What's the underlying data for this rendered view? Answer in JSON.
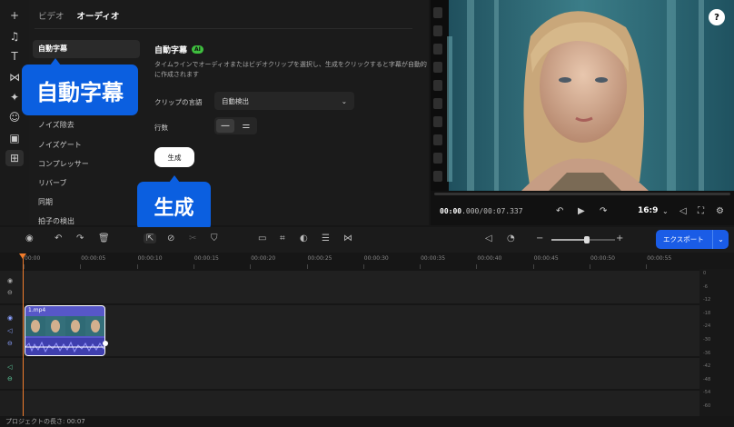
{
  "rail": {
    "icons": [
      "plus-icon",
      "music-icon",
      "text-icon",
      "transition-icon",
      "effects-icon",
      "sticker-icon",
      "record-icon",
      "apps-icon"
    ]
  },
  "panel": {
    "tabs": [
      "ビデオ",
      "オーディオ"
    ],
    "active_tab": "オーディオ",
    "side_items": [
      "自動字幕",
      "ノイズ除去",
      "ノイズゲート",
      "コンプレッサー",
      "リバーブ",
      "同期",
      "拍子の検出"
    ],
    "title": "自動字幕",
    "ai_badge": "AI",
    "description": "タイムラインでオーディオまたはビデオクリップを選択し、生成をクリックすると字幕が自動的に作成されます",
    "clip_language_label": "クリップの言語",
    "clip_language_value": "自動検出",
    "rows_label": "行数",
    "generate_button": "生成"
  },
  "callouts": {
    "auto_subtitles": "自動字幕",
    "generate": "生成"
  },
  "preview": {
    "help_label": "?",
    "timecode_current": "00:00",
    "timecode_rest": ".000/00:07.337",
    "aspect_ratio": "16:9"
  },
  "toolbar": {
    "export_label": "エクスポート",
    "zoom_level": 0.55
  },
  "ruler": {
    "labels": [
      "00:00",
      "00:00:05",
      "00:00:10",
      "00:00:15",
      "00:00:20",
      "00:00:25",
      "00:00:30",
      "00:00:35",
      "00:00:40",
      "00:00:45",
      "00:00:50",
      "00:00:55"
    ]
  },
  "timeline": {
    "clip_name": "1.mp4"
  },
  "meter": {
    "labels": [
      "0",
      "-6",
      "-12",
      "-18",
      "-24",
      "-30",
      "-36",
      "-42",
      "-48",
      "-54",
      "-60"
    ]
  },
  "footer": {
    "project_length": "プロジェクトの長さ: 00:07"
  },
  "colors": {
    "accent": "#1a5ce6",
    "clip": "#5757c8",
    "playhead": "#f07c2c",
    "ai_badge": "#3fbf3f"
  }
}
